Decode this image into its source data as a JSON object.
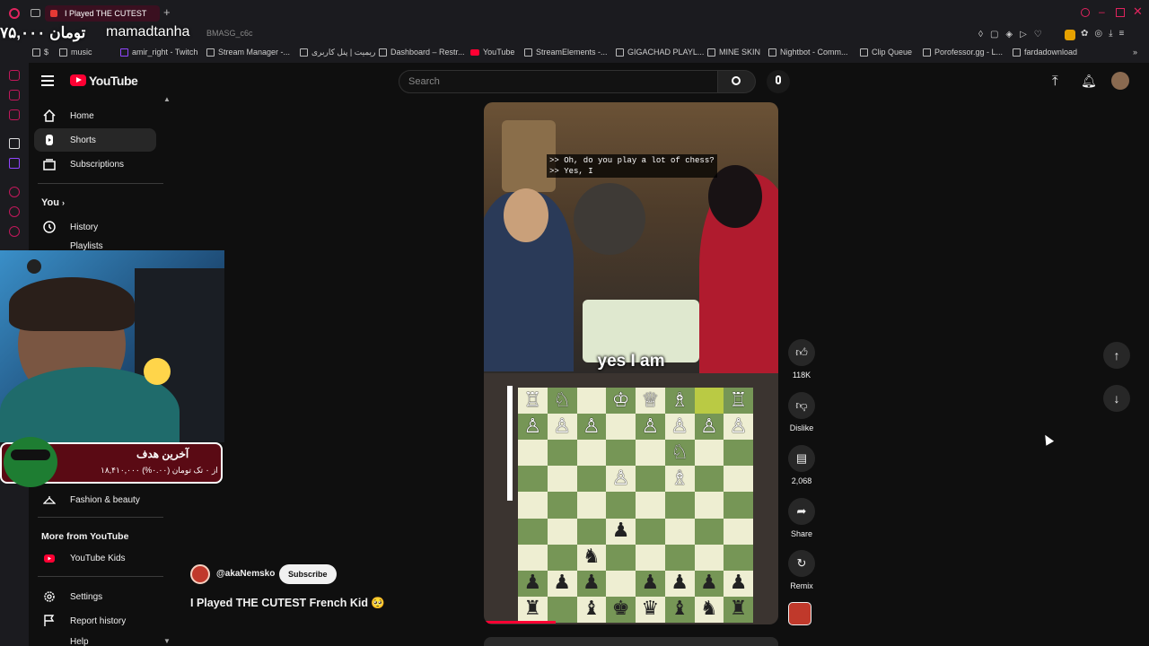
{
  "browser": {
    "tab_title": "I Played THE CUTEST",
    "address_fragment": "BMASG_c6c",
    "bookmarks": [
      "$",
      "music",
      "amir_right - Twitch",
      "Stream Manager -...",
      "ریمیت | پنل کاربری",
      "Dashboard – Restr...",
      "YouTube",
      "StreamElements -...",
      "GIGACHAD PLAYL...",
      "MINE SKIN",
      "Nightbot - Comm...",
      "Clip Queue",
      "Porofessor.gg - L...",
      "fardadownload"
    ]
  },
  "overlay": {
    "price": "۷۵,۰۰۰ تومان",
    "streamer": "mamadtanha",
    "goal_title": "آخرین هدف",
    "goal_text": "۱۸,۴۱۰,۰۰۰ از ۰ تک تومان (۰.۰۰%)"
  },
  "youtube": {
    "logo": "YouTube",
    "search_placeholder": "Search",
    "sidebar": {
      "main": [
        {
          "label": "Home",
          "icon": "home-icon"
        },
        {
          "label": "Shorts",
          "icon": "shorts-icon"
        },
        {
          "label": "Subscriptions",
          "icon": "subscriptions-icon"
        }
      ],
      "you_title": "You",
      "you_items": [
        {
          "label": "History",
          "icon": "history-icon"
        },
        {
          "label": "Playlists",
          "icon": "playlist-icon"
        }
      ],
      "explore_visible": {
        "label": "Fashion & beauty",
        "icon": "hanger-icon"
      },
      "more_title": "More from YouTube",
      "more_items": [
        {
          "label": "YouTube Kids",
          "icon": "youtube-kids-icon"
        }
      ],
      "bottom_items": [
        {
          "label": "Settings",
          "icon": "gear-icon"
        },
        {
          "label": "Report history",
          "icon": "flag-icon"
        },
        {
          "label": "Help",
          "icon": "help-icon"
        }
      ]
    },
    "short": {
      "caption": ">> Oh, do you play a lot of chess?\n>> Yes, I",
      "subtitle": "yes I am",
      "channel": "@akaNemsko",
      "subscribe": "Subscribe",
      "title": "I Played THE CUTEST French Kid 🥺",
      "board": [
        [
          "wR",
          "wN",
          "",
          "wK",
          "wQ",
          "wB",
          "hl",
          "wR"
        ],
        [
          "wP",
          "wP",
          "wP",
          "",
          "wP",
          "wP",
          "wP",
          "wP"
        ],
        [
          "",
          "",
          "",
          "",
          "",
          "wN",
          "",
          ""
        ],
        [
          "",
          "",
          "",
          "wP",
          "",
          "wB",
          "",
          ""
        ],
        [
          "",
          "",
          "",
          "",
          "",
          "",
          "",
          ""
        ],
        [
          "",
          "",
          "",
          "bP",
          "",
          "",
          "",
          ""
        ],
        [
          "",
          "",
          "bN",
          "",
          "",
          "",
          "",
          ""
        ],
        [
          "bP",
          "bP",
          "bP",
          "",
          "bP",
          "bP",
          "bP",
          "bP"
        ],
        [
          "bR",
          "",
          "bB",
          "bK",
          "bQ",
          "bB",
          "bN",
          "bR"
        ]
      ],
      "actions": {
        "likes": "118K",
        "dislike": "Dislike",
        "comments": "2,068",
        "share": "Share",
        "remix": "Remix"
      }
    }
  }
}
